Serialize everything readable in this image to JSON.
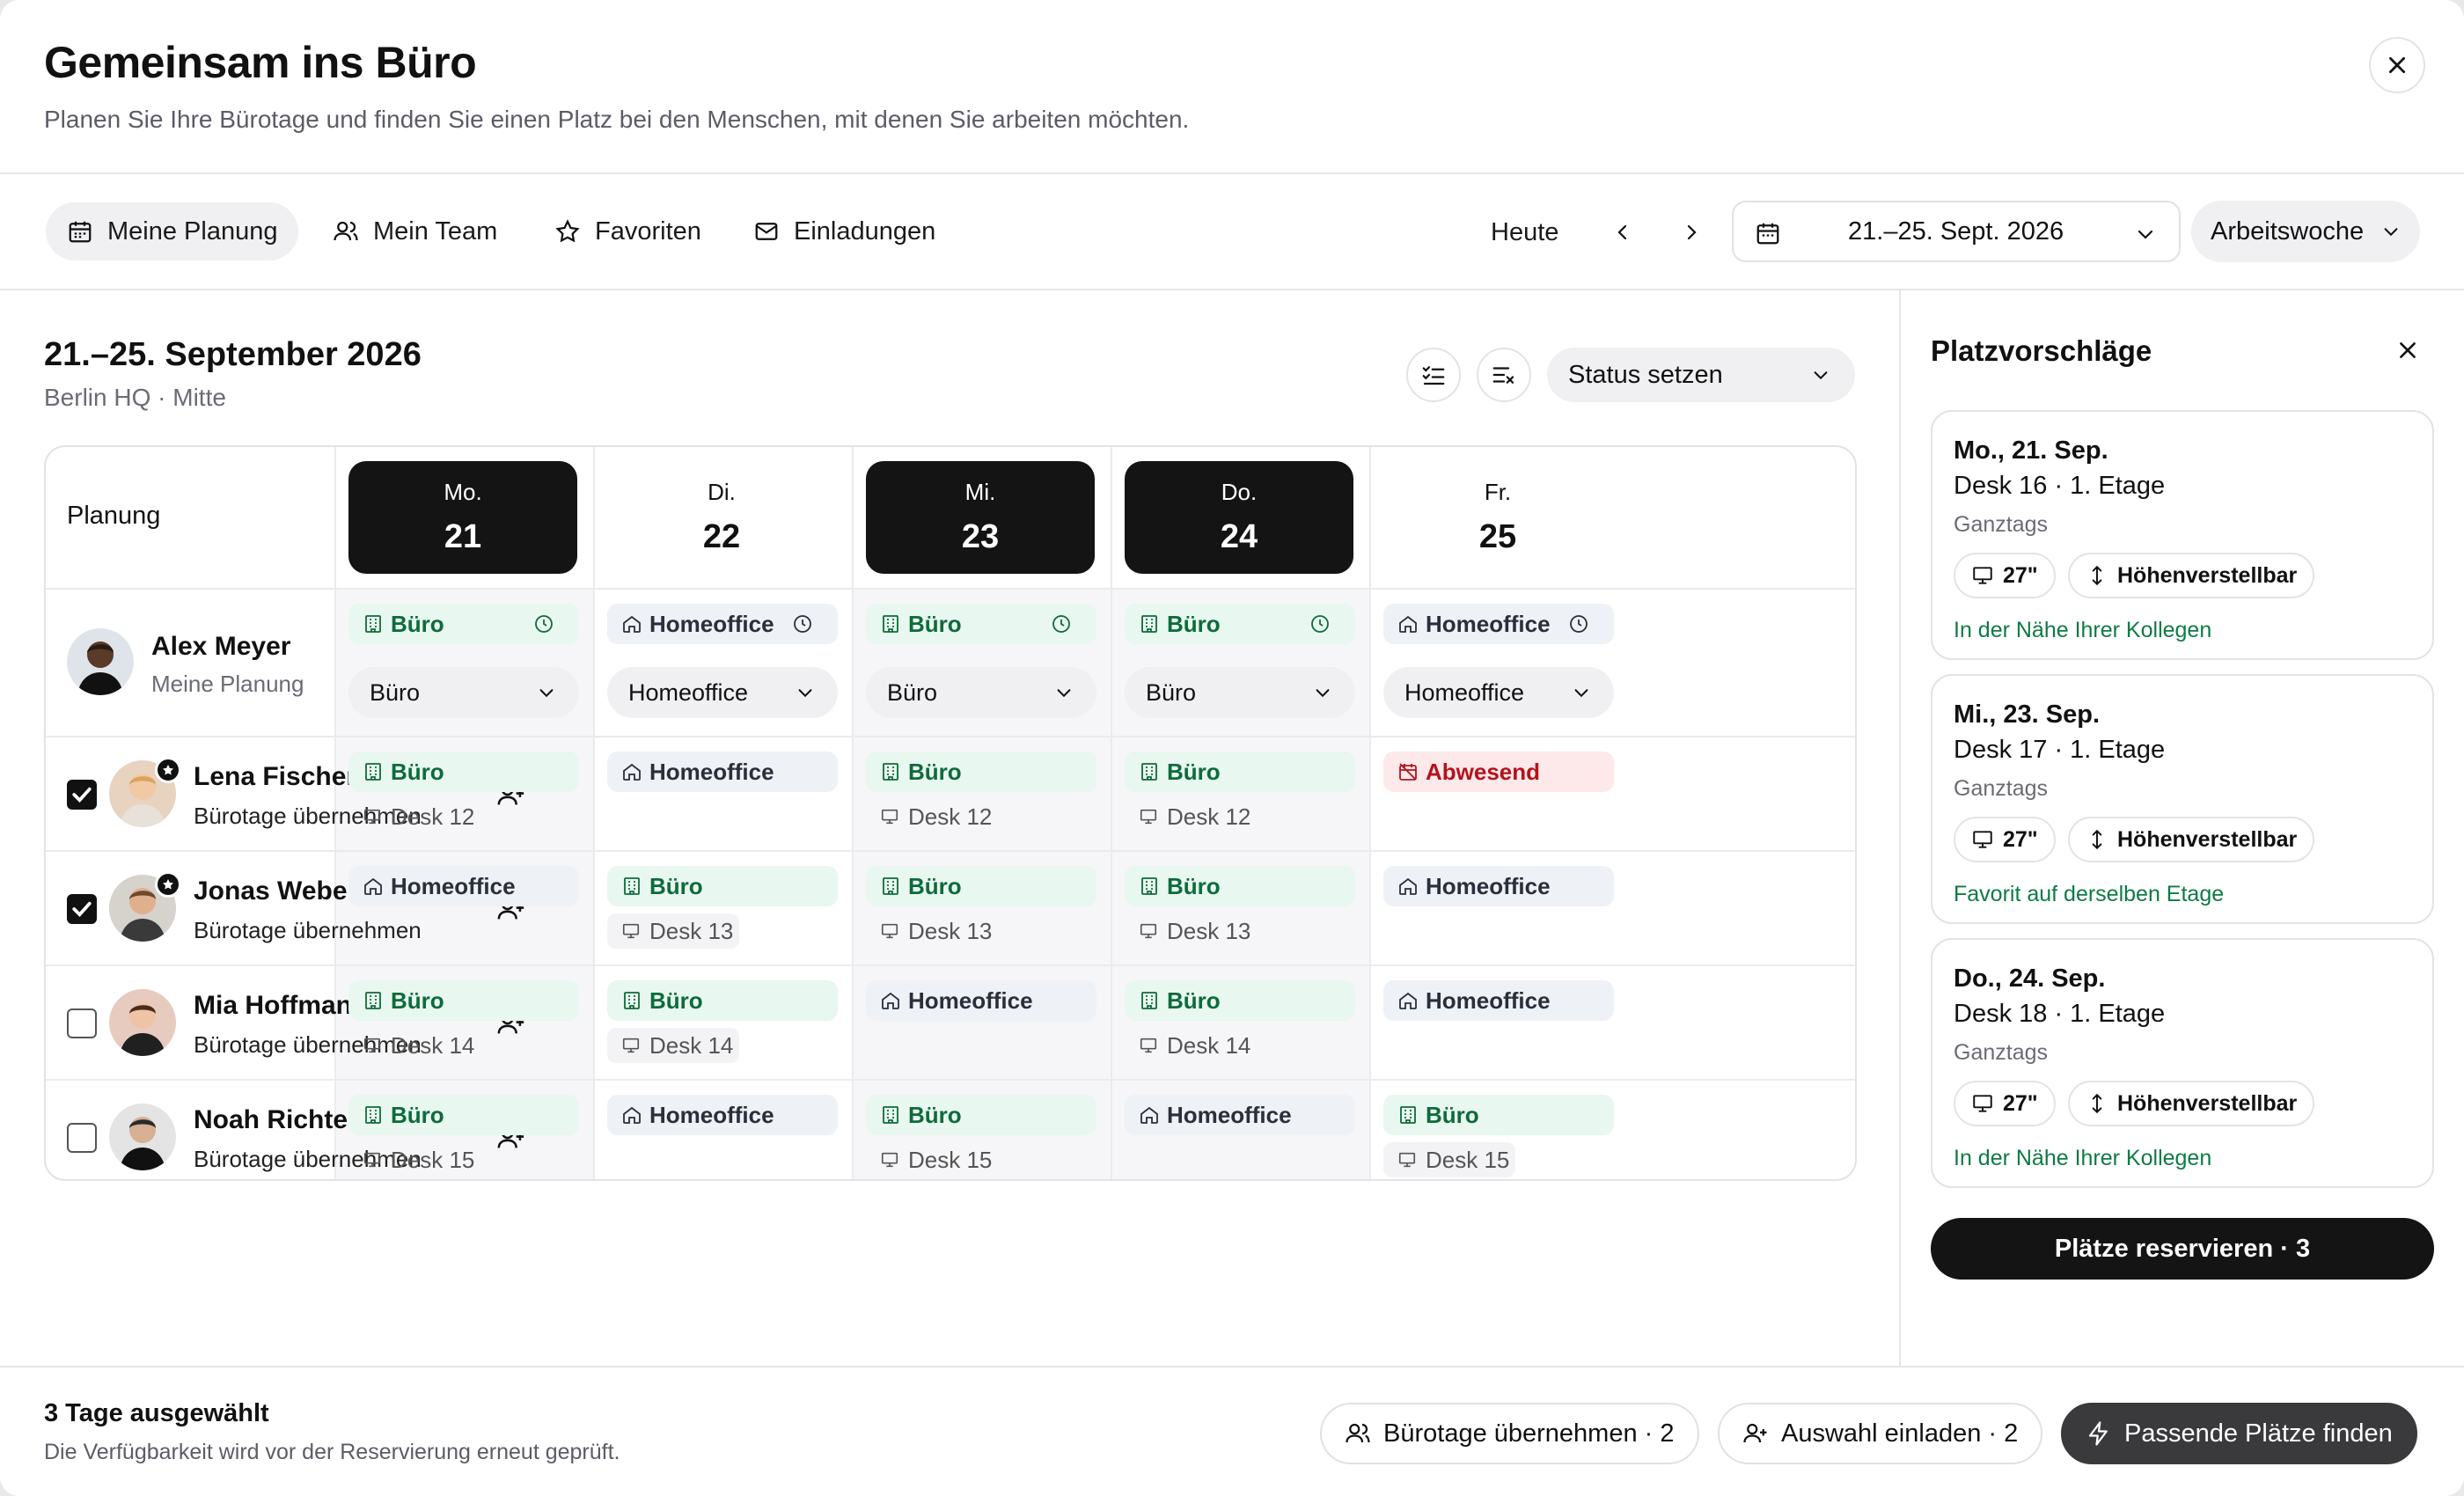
{
  "header": {
    "title": "Gemeinsam ins Büro",
    "subtitle": "Planen Sie Ihre Bürotage und finden Sie einen Platz bei den Menschen, mit denen Sie arbeiten möchten."
  },
  "toolbar": {
    "tabs": [
      {
        "label": "Meine Planung",
        "active": true
      },
      {
        "label": "Mein Team"
      },
      {
        "label": "Favoriten"
      },
      {
        "label": "Einladungen"
      }
    ],
    "today": "Heute",
    "date_range": "21.–25. Sept. 2026",
    "view": "Arbeitswoche"
  },
  "main": {
    "week_title": "21.–25. September 2026",
    "location": "Berlin HQ · Mitte",
    "status_select": "Status setzen",
    "grid_header": "Planung",
    "days": [
      {
        "name": "Mo.",
        "num": "21",
        "selected": true
      },
      {
        "name": "Di.",
        "num": "22",
        "selected": false
      },
      {
        "name": "Mi.",
        "num": "23",
        "selected": true
      },
      {
        "name": "Do.",
        "num": "24",
        "selected": true
      },
      {
        "name": "Fr.",
        "num": "25",
        "selected": false
      }
    ],
    "me": {
      "name": "Alex Meyer",
      "sub": "Meine Planung",
      "days": [
        {
          "status": "Büro",
          "select": "Büro"
        },
        {
          "status": "Homeoffice",
          "select": "Homeoffice"
        },
        {
          "status": "Büro",
          "select": "Büro"
        },
        {
          "status": "Büro",
          "select": "Büro"
        },
        {
          "status": "Homeoffice",
          "select": "Homeoffice"
        }
      ]
    },
    "people": [
      {
        "name": "Lena Fischer",
        "sub": "Bürotage übernehmen",
        "checked": true,
        "favorite": true,
        "days": [
          {
            "status": "Büro",
            "desk": "Desk 12"
          },
          {
            "status": "Homeoffice",
            "desk": ""
          },
          {
            "status": "Büro",
            "desk": "Desk 12"
          },
          {
            "status": "Büro",
            "desk": "Desk 12"
          },
          {
            "status": "Abwesend",
            "desk": ""
          }
        ]
      },
      {
        "name": "Jonas Weber",
        "sub": "Bürotage übernehmen",
        "checked": true,
        "favorite": true,
        "days": [
          {
            "status": "Homeoffice",
            "desk": ""
          },
          {
            "status": "Büro",
            "desk": "Desk 13"
          },
          {
            "status": "Büro",
            "desk": "Desk 13"
          },
          {
            "status": "Büro",
            "desk": "Desk 13"
          },
          {
            "status": "Homeoffice",
            "desk": ""
          }
        ]
      },
      {
        "name": "Mia Hoffmann",
        "sub": "Bürotage übernehmen",
        "checked": false,
        "favorite": false,
        "days": [
          {
            "status": "Büro",
            "desk": "Desk 14"
          },
          {
            "status": "Büro",
            "desk": "Desk 14"
          },
          {
            "status": "Homeoffice",
            "desk": ""
          },
          {
            "status": "Büro",
            "desk": "Desk 14"
          },
          {
            "status": "Homeoffice",
            "desk": ""
          }
        ]
      },
      {
        "name": "Noah Richter",
        "sub": "Bürotage übernehmen",
        "checked": false,
        "favorite": false,
        "days": [
          {
            "status": "Büro",
            "desk": "Desk 15"
          },
          {
            "status": "Homeoffice",
            "desk": ""
          },
          {
            "status": "Büro",
            "desk": "Desk 15"
          },
          {
            "status": "Homeoffice",
            "desk": ""
          },
          {
            "status": "Büro",
            "desk": "Desk 15"
          }
        ]
      }
    ]
  },
  "side": {
    "title": "Platzvorschläge",
    "cards": [
      {
        "date": "Mo., 21. Sep.",
        "desk": "Desk 16 · 1. Etage",
        "time": "Ganztags",
        "screen": "27\"",
        "feature": "Höhenverstellbar",
        "note": "In der Nähe Ihrer Kollegen"
      },
      {
        "date": "Mi., 23. Sep.",
        "desk": "Desk 17 · 1. Etage",
        "time": "Ganztags",
        "screen": "27\"",
        "feature": "Höhenverstellbar",
        "note": "Favorit auf derselben Etage"
      },
      {
        "date": "Do., 24. Sep.",
        "desk": "Desk 18 · 1. Etage",
        "time": "Ganztags",
        "screen": "27\"",
        "feature": "Höhenverstellbar",
        "note": "In der Nähe Ihrer Kollegen"
      }
    ],
    "reserve": "Plätze reservieren · 3"
  },
  "footer": {
    "title": "3 Tage ausgewählt",
    "sub": "Die Verfügbarkeit wird vor der Reservierung erneut geprüft.",
    "btn_adopt": "Bürotage übernehmen · 2",
    "btn_invite": "Auswahl einladen · 2",
    "btn_find": "Passende Plätze finden"
  },
  "colors": {
    "office_bg": "#e8f7ef",
    "office_text": "#0e6b3b",
    "home_bg": "#eef1f6",
    "absent_bg": "#fde8ea",
    "absent_text": "#b4131c",
    "dark": "#141414",
    "note_green": "#0e7b44"
  }
}
